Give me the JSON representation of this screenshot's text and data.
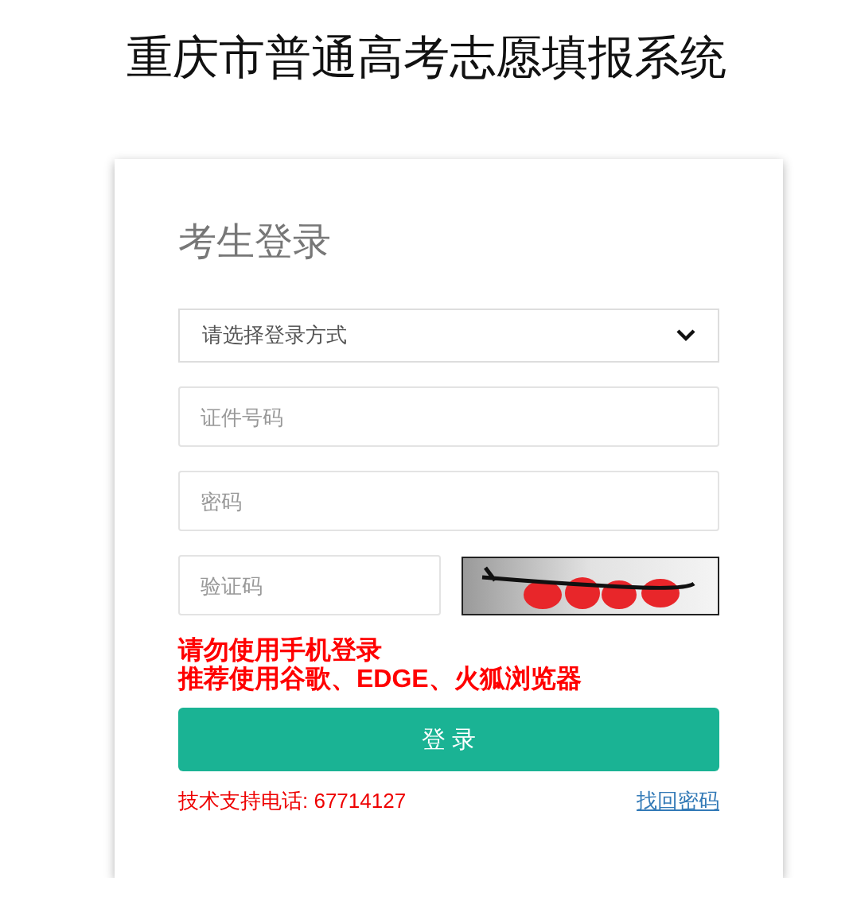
{
  "title": "重庆市普通高考志愿填报系统",
  "login": {
    "heading": "考生登录",
    "method_select": {
      "value": "请选择登录方式"
    },
    "id_number_field": {
      "placeholder": "证件号码"
    },
    "password_field": {
      "placeholder": "密码"
    },
    "captcha": {
      "placeholder": "验证码"
    },
    "notices": [
      "请勿使用手机登录",
      "推荐使用谷歌、EDGE、火狐浏览器"
    ],
    "submit_button": "登 录",
    "support_text": "技术支持电话: 67714127",
    "forgot_password_link": "找回密码"
  }
}
